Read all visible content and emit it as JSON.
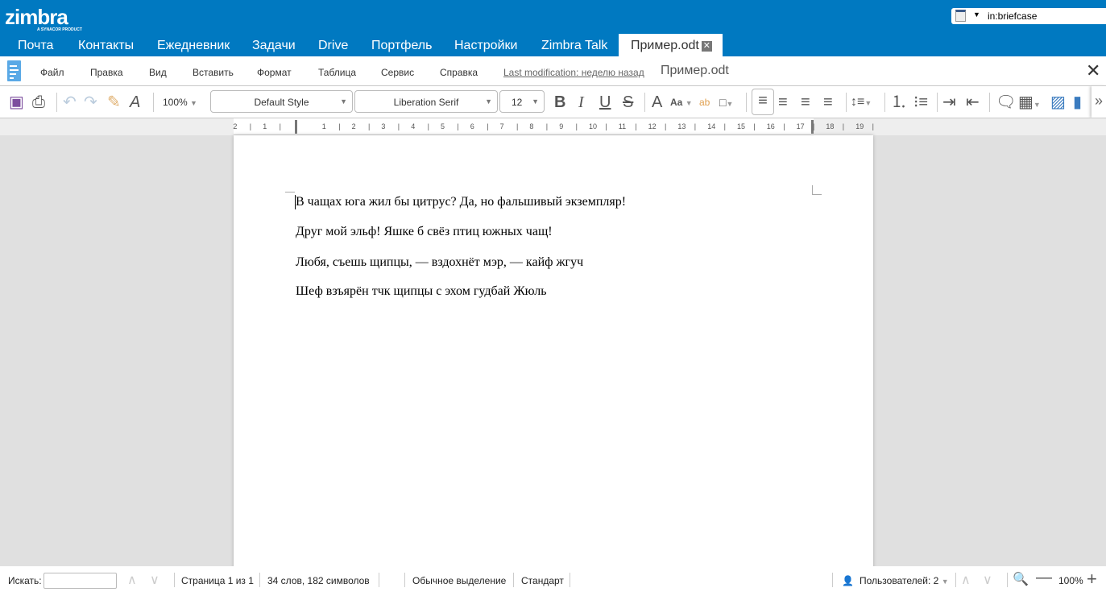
{
  "header": {
    "logo": "zimbra",
    "logo_sub": "A SYNACOR PRODUCT",
    "search_value": "in:briefcase"
  },
  "tabs": [
    {
      "label": "Почта"
    },
    {
      "label": "Контакты"
    },
    {
      "label": "Ежедневник"
    },
    {
      "label": "Задачи"
    },
    {
      "label": "Drive"
    },
    {
      "label": "Портфель"
    },
    {
      "label": "Настройки"
    },
    {
      "label": "Zimbra Talk"
    },
    {
      "label": "Пример.odt",
      "active": true
    }
  ],
  "menubar": {
    "items": [
      "Файл",
      "Правка",
      "Вид",
      "Вставить",
      "Формат",
      "Таблица",
      "Сервис",
      "Справка"
    ],
    "last_modification": "Last modification: неделю назад",
    "doc_title": "Пример.odt"
  },
  "toolbar": {
    "zoom": "100%",
    "style": "Default Style",
    "font": "Liberation Serif",
    "size": "12"
  },
  "ruler": {
    "labels": [
      "2",
      "1",
      "1",
      "2",
      "3",
      "4",
      "5",
      "6",
      "7",
      "8",
      "9",
      "10",
      "11",
      "12",
      "13",
      "14",
      "15",
      "16",
      "17",
      "18",
      "19"
    ]
  },
  "document": {
    "paragraphs": [
      "В чащах юга жил бы цитрус? Да, но фальшивый экземпляр!",
      "Друг мой эльф! Яшке б свёз птиц южных чащ!",
      "Любя, съешь щипцы, — вздохнёт мэр, — кайф жгуч",
      "Шеф взъярён тчк щипцы с эхом гудбай Жюль"
    ]
  },
  "status": {
    "find_label": "Искать:",
    "page": "Страница 1 из 1",
    "counts": "34 слов, 182 символов",
    "selection": "Обычное выделение",
    "mode": "Стандарт",
    "users": "Пользователей: 2",
    "zoom": "100%"
  },
  "colors": {
    "brand": "#0079c1"
  }
}
